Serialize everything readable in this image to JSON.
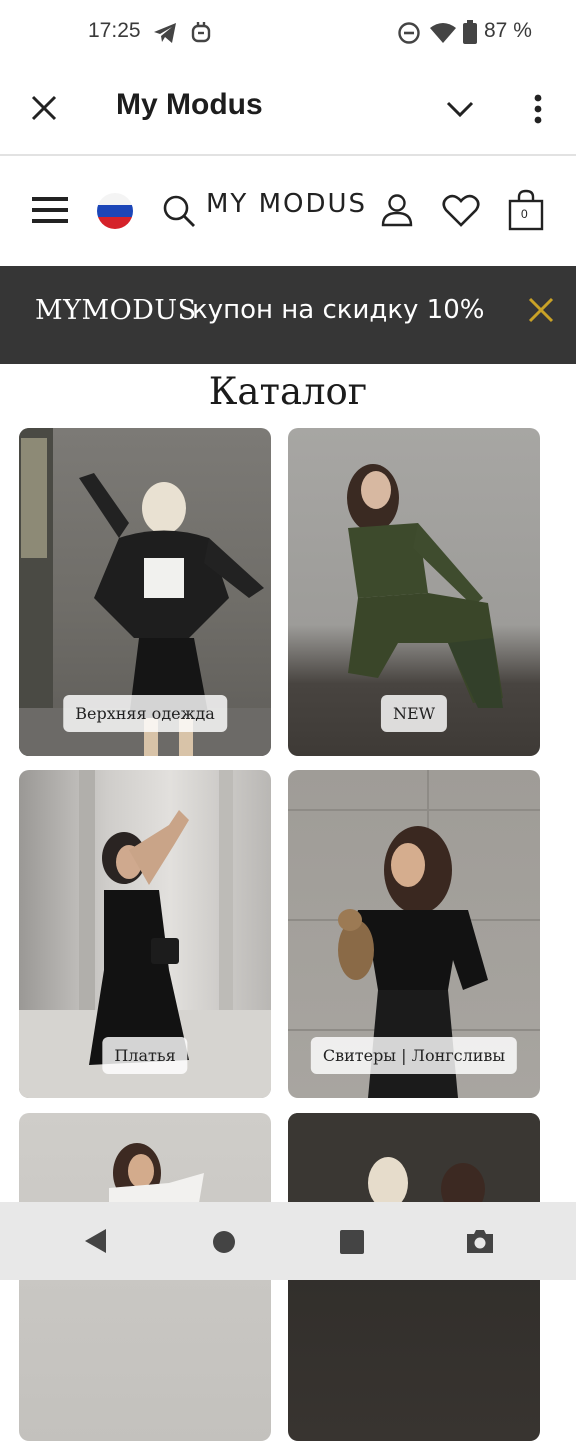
{
  "status_bar": {
    "time": "17:25",
    "battery_text": "87 %",
    "icons": [
      "telegram-icon",
      "app-notification-icon",
      "do-not-disturb-icon",
      "wifi-icon",
      "battery-icon"
    ]
  },
  "toolbar": {
    "title": "My Modus",
    "icons": [
      "close-icon",
      "chevron-down-icon",
      "more-vert-icon"
    ]
  },
  "site_header": {
    "logo": "MY MODUS",
    "cart_count": "0",
    "icons": [
      "menu-icon",
      "russia-flag-icon",
      "search-icon",
      "user-icon",
      "heart-icon",
      "bag-icon"
    ]
  },
  "banner": {
    "brand": "MYMODUS",
    "text": "купон на скидку 10%",
    "accent_color": "#c9a227"
  },
  "catalog": {
    "title": "Каталог",
    "categories": [
      {
        "label": "Верхняя одежда"
      },
      {
        "label": "NEW"
      },
      {
        "label": "Платья"
      },
      {
        "label": "Свитеры | Лонгсливы"
      },
      {
        "label": ""
      },
      {
        "label": ""
      }
    ]
  },
  "nav_bar": {
    "icons": [
      "back-icon",
      "home-icon",
      "recents-icon",
      "screenshot-icon"
    ]
  }
}
